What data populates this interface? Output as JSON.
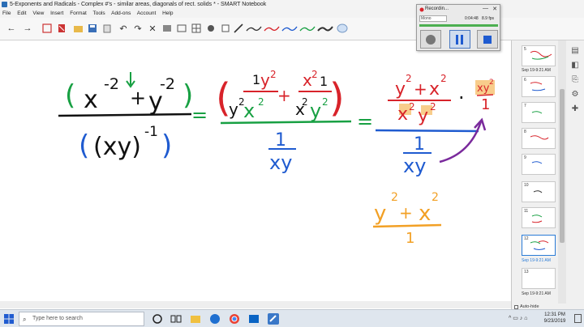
{
  "window": {
    "title": "5-Exponents and Radicals - Complex #'s - similar areas, diagonals of rect. solids * - SMART Notebook"
  },
  "menu": {
    "items": [
      "File",
      "Edit",
      "View",
      "Insert",
      "Format",
      "Tools",
      "Add-ons",
      "Account",
      "Help"
    ]
  },
  "recorder": {
    "title": "Recordin...",
    "source": "Mono",
    "elapsed": "0:04:48",
    "fps": "8.9 fps",
    "min_glyph": "—",
    "close_glyph": "✕"
  },
  "page_panel": {
    "thumbnails": [
      {
        "num": "5",
        "date": "Sep 19-9:21 AM"
      },
      {
        "num": "6",
        "date": ""
      },
      {
        "num": "7",
        "date": ""
      },
      {
        "num": "8",
        "date": ""
      },
      {
        "num": "9",
        "date": ""
      },
      {
        "num": "10",
        "date": ""
      },
      {
        "num": "11",
        "date": ""
      },
      {
        "num": "12",
        "date": "Sep 19-9:21 AM"
      },
      {
        "num": "13",
        "date": "Sep 19-9:21 AM"
      }
    ],
    "auto_hide_label": "Auto-hide"
  },
  "taskbar": {
    "search_placeholder": "Type here to search",
    "time": "12:31 PM",
    "date": "9/23/2019"
  },
  "math": {
    "x": "x",
    "y": "y",
    "exp_neg2": "-2",
    "exp_neg1": "-1",
    "exp_2": "2",
    "plus": "+",
    "equals": "=",
    "one": "1",
    "xy": "xy",
    "dot": "·",
    "paren_xy": "(xy)",
    "open_paren": "(",
    "close_paren": ")"
  },
  "colors": {
    "green": "#18a043",
    "red": "#d8232a",
    "blue": "#1f5bd0",
    "purple": "#7a2a9c",
    "orange": "#f2a025",
    "highlight": "#f5b85a"
  }
}
